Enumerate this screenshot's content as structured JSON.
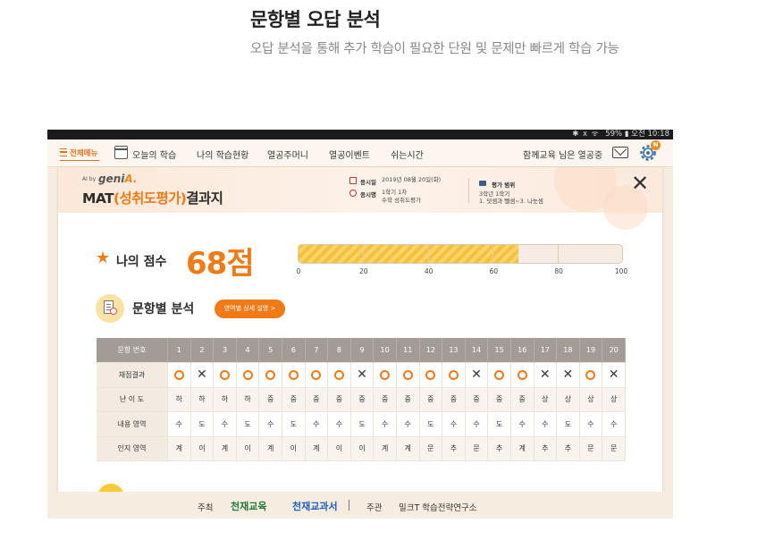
{
  "hero": {
    "title": "문항별 오답 분석",
    "subtitle": "오답 분석을 통해 추가 학습이 필요한 단원 및 문제만 빠르게 학습 가능"
  },
  "statusbar": {
    "icons": "✱ ⅹ ᯤ",
    "battery": "59%",
    "time_label": "오전 10:18"
  },
  "nav": {
    "menu_label": "전체메뉴",
    "items": [
      "오늘의 학습",
      "나의 학습현황",
      "열공주머니",
      "열공이벤트",
      "쉬는시간"
    ],
    "user": "함께교육 님은 열공중",
    "badge": "N",
    "icons": [
      "menu-icon",
      "calendar-icon",
      "mail-icon",
      "gear-icon"
    ]
  },
  "report": {
    "brand_small": "AI by",
    "brand_name": "geni",
    "brand_suffix": "A.",
    "title_prefix": "MAT",
    "title_highlight": "(성취도평가)",
    "title_suffix": "결과지",
    "date_label": "응시일",
    "date_value": "2019년 08월 20일(화)",
    "count_label": "응시명",
    "count_value_1": "1학기 1차",
    "count_value_2": "수학 성취도평가",
    "range_label": "평가 범위",
    "range_value_1": "3학년 1학기",
    "range_value_2": "1. 덧셈과 뺄셈~3. 나눗셈",
    "close_icon": "✕"
  },
  "score": {
    "star": "★",
    "label": "나의 점수",
    "value_text": "68점",
    "value": 68,
    "max": 100,
    "ticks": [
      "0",
      "20",
      "40",
      "60",
      "80",
      "100"
    ]
  },
  "analysis": {
    "title": "문항별 분석",
    "detail_button": "영역별 상세 설명 >",
    "header_label": "문항 번호",
    "numbers": [
      "1",
      "2",
      "3",
      "4",
      "5",
      "6",
      "7",
      "8",
      "9",
      "10",
      "11",
      "12",
      "13",
      "14",
      "15",
      "16",
      "17",
      "18",
      "19",
      "20"
    ],
    "rows": [
      {
        "label": "채점결과",
        "type": "mark",
        "values": [
          "O",
          "X",
          "O",
          "O",
          "O",
          "O",
          "O",
          "O",
          "X",
          "O",
          "O",
          "O",
          "O",
          "X",
          "O",
          "O",
          "X",
          "X",
          "O",
          "X"
        ]
      },
      {
        "label": "난 이 도",
        "type": "text",
        "values": [
          "하",
          "하",
          "하",
          "하",
          "중",
          "중",
          "중",
          "중",
          "중",
          "중",
          "중",
          "중",
          "중",
          "중",
          "중",
          "중",
          "상",
          "상",
          "상",
          "상"
        ]
      },
      {
        "label": "내용 영역",
        "type": "text",
        "values": [
          "수",
          "도",
          "수",
          "도",
          "수",
          "도",
          "수",
          "수",
          "도",
          "수",
          "수",
          "도",
          "수",
          "수",
          "도",
          "수",
          "수",
          "도",
          "수",
          "수"
        ]
      },
      {
        "label": "인지 영역",
        "type": "text",
        "values": [
          "계",
          "이",
          "계",
          "이",
          "계",
          "이",
          "계",
          "이",
          "이",
          "계",
          "계",
          "문",
          "추",
          "문",
          "추",
          "계",
          "추",
          "추",
          "문",
          "문"
        ]
      }
    ]
  },
  "footer": {
    "host_label": "주최",
    "host_logo_1": "천재교육",
    "host_logo_2": "천재교과서",
    "organizer_label": "주관",
    "organizer": "밀크T 학습전략연구소"
  },
  "colors": {
    "accent": "#f07a18",
    "bar": "#f5c13b",
    "header": "#a39b95",
    "background": "#f7ece0"
  }
}
